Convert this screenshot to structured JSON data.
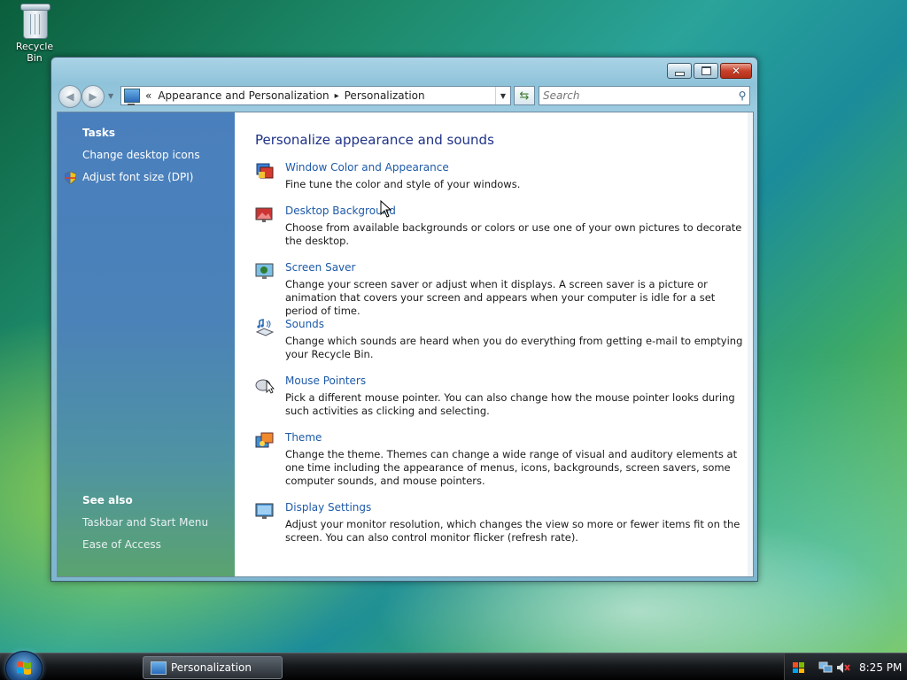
{
  "desktop": {
    "recycle_bin_label": "Recycle Bin"
  },
  "window": {
    "title": "Personalization",
    "breadcrumb": {
      "overflow": "«",
      "parent": "Appearance and Personalization",
      "separator": "▸",
      "current": "Personalization"
    },
    "search_placeholder": "Search"
  },
  "sidebar": {
    "tasks_heading": "Tasks",
    "tasks": [
      "Change desktop icons",
      "Adjust font size (DPI)"
    ],
    "see_also_heading": "See also",
    "see_also": [
      "Taskbar and Start Menu",
      "Ease of Access"
    ]
  },
  "main": {
    "heading": "Personalize appearance and sounds",
    "items": [
      {
        "icon": "window-color-icon",
        "title": "Window Color and Appearance",
        "desc": "Fine tune the color and style of your windows."
      },
      {
        "icon": "desktop-background-icon",
        "title": "Desktop Background",
        "desc": "Choose from available backgrounds or colors or use one of your own pictures to decorate the desktop."
      },
      {
        "icon": "screen-saver-icon",
        "title": "Screen Saver",
        "desc": "Change your screen saver or adjust when it displays. A screen saver is a picture or animation that covers your screen and appears when your computer is idle for a set period of time."
      },
      {
        "icon": "sounds-icon",
        "title": "Sounds",
        "desc": "Change which sounds are heard when you do everything from getting e-mail to emptying your Recycle Bin."
      },
      {
        "icon": "mouse-pointers-icon",
        "title": "Mouse Pointers",
        "desc": "Pick a different mouse pointer. You can also change how the mouse pointer looks during such activities as clicking and selecting."
      },
      {
        "icon": "theme-icon",
        "title": "Theme",
        "desc": "Change the theme. Themes can change a wide range of visual and auditory elements at one time including the appearance of menus, icons, backgrounds, screen savers, some computer sounds, and mouse pointers."
      },
      {
        "icon": "display-settings-icon",
        "title": "Display Settings",
        "desc": "Adjust your monitor resolution, which changes the view so more or fewer items fit on the screen. You can also control monitor flicker (refresh rate)."
      }
    ]
  },
  "taskbar": {
    "task_label": "Personalization",
    "clock": "8:25 PM"
  },
  "colors": {
    "link": "#1e5aa8",
    "heading": "#1e3287",
    "sidebar": "#4a7fbd"
  }
}
